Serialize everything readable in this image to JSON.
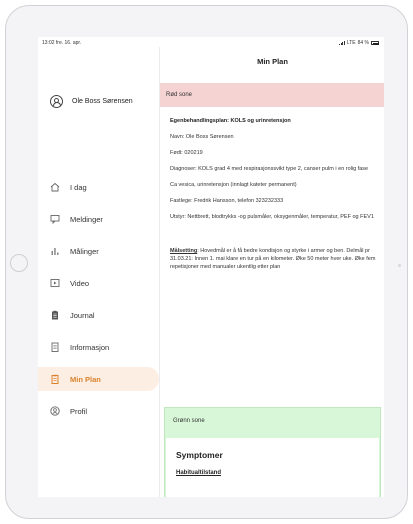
{
  "statusbar": {
    "time": "13:02 fre. 16. apr.",
    "network": "LTE",
    "battery": "84 %"
  },
  "user": {
    "name": "Ole Boss Sørensen"
  },
  "nav": [
    {
      "label": "I dag",
      "icon": "home-icon"
    },
    {
      "label": "Meldinger",
      "icon": "chat-icon"
    },
    {
      "label": "Målinger",
      "icon": "bar-chart-icon"
    },
    {
      "label": "Video",
      "icon": "video-icon"
    },
    {
      "label": "Journal",
      "icon": "clipboard-icon"
    },
    {
      "label": "Informasjon",
      "icon": "document-icon"
    },
    {
      "label": "Min Plan",
      "icon": "plan-icon",
      "active": true
    },
    {
      "label": "Profil",
      "icon": "profile-icon"
    }
  ],
  "main": {
    "title": "Min Plan",
    "red_zone_label": "Rød sone",
    "plan_title": "Egenbehandlingsplan:  KOLS og urinretensjon",
    "name_line": "Navn: Ole Boss Sørensen",
    "born_line": "Født: 020219",
    "diagnosis_line": "Diagnoser: KOLS grad 4 med respirasjonssvikt type 2, canser pulm i en rolig fase",
    "diagnosis_line2": "Ca vesica, urinretensjon (innlagt kateter permanent)",
    "doctor_line": "Fastlege: Fredrik Hansson, telefon 323232333",
    "equipment_line": "Utstyr: Nettbrett, blodtrykks -og pulsmåler, oksygenmåler, temperatur, PEF og FEV1",
    "goal_label": "Målsetting",
    "goal_text": ": Hovedmål er å få bedre kondisjon og styrke i armer og ben. Delmål pr 31.03.21: Innen 1. mai klare en tur på en kilometer. Øke 50 meter hver uke. Øke fem repetisjoner med manualer ukentlig etter plan",
    "green_zone_label": "Grønn sone",
    "symptoms_title": "Symptomer",
    "habitual_label": "Habitualtilstand"
  },
  "colors": {
    "accent": "#d9822b",
    "active_bg": "#fdeee3",
    "red_zone": "#f6d3d3",
    "green_zone": "#d8f7d8"
  }
}
